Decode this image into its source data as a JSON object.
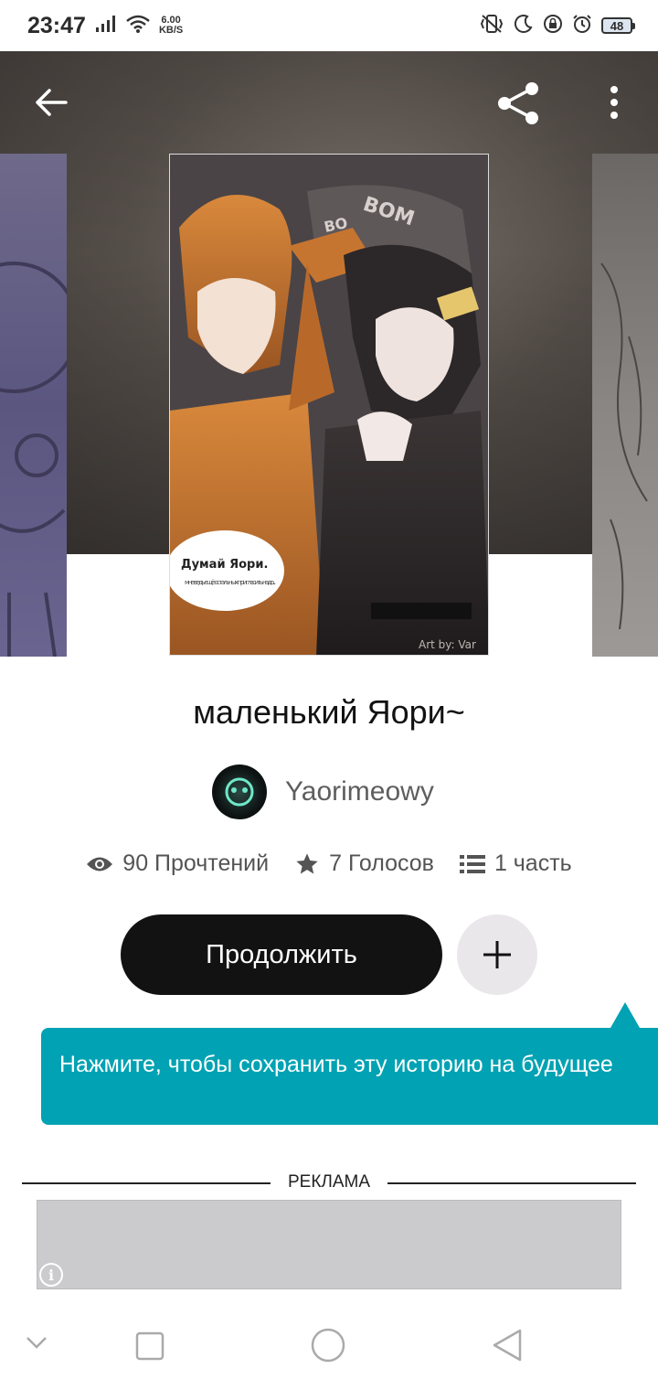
{
  "status_bar": {
    "time": "23:47",
    "net_speed_value": "6.00",
    "net_speed_unit": "KB/S",
    "battery": "48",
    "icons": [
      "signal-icon",
      "wifi-icon",
      "vibrate-icon",
      "moon-icon",
      "lock-rotation-icon",
      "alarm-icon",
      "battery-icon"
    ]
  },
  "header": {
    "back_icon": "arrow-left-icon",
    "share_icon": "share-icon",
    "more_icon": "more-vertical-icon"
  },
  "cover": {
    "speech_title": "Думай Яори.",
    "speech_sub": "мне ведь ещё остальных пригласить надо...",
    "sfx": "BOM",
    "sfx2": "BO",
    "signature": "Art by: Var"
  },
  "story": {
    "title": "маленький Яори~",
    "author": "Yaorimeowy",
    "stats": {
      "reads": "90 Прочтений",
      "votes": "7 Голосов",
      "parts": "1 часть"
    },
    "continue_label": "Продолжить",
    "add_icon": "plus-icon"
  },
  "tooltip": {
    "text": "Нажмите, чтобы сохранить эту историю на будущее"
  },
  "ad": {
    "label": "РЕКЛАМА",
    "info_glyph": "i"
  },
  "nav": {
    "icons": [
      "chevron-down-icon",
      "recents-square-icon",
      "home-circle-icon",
      "back-triangle-icon"
    ]
  },
  "colors": {
    "accent_tooltip": "#00a2b3",
    "primary_button": "#121212",
    "secondary_button": "#e9e7ea"
  }
}
